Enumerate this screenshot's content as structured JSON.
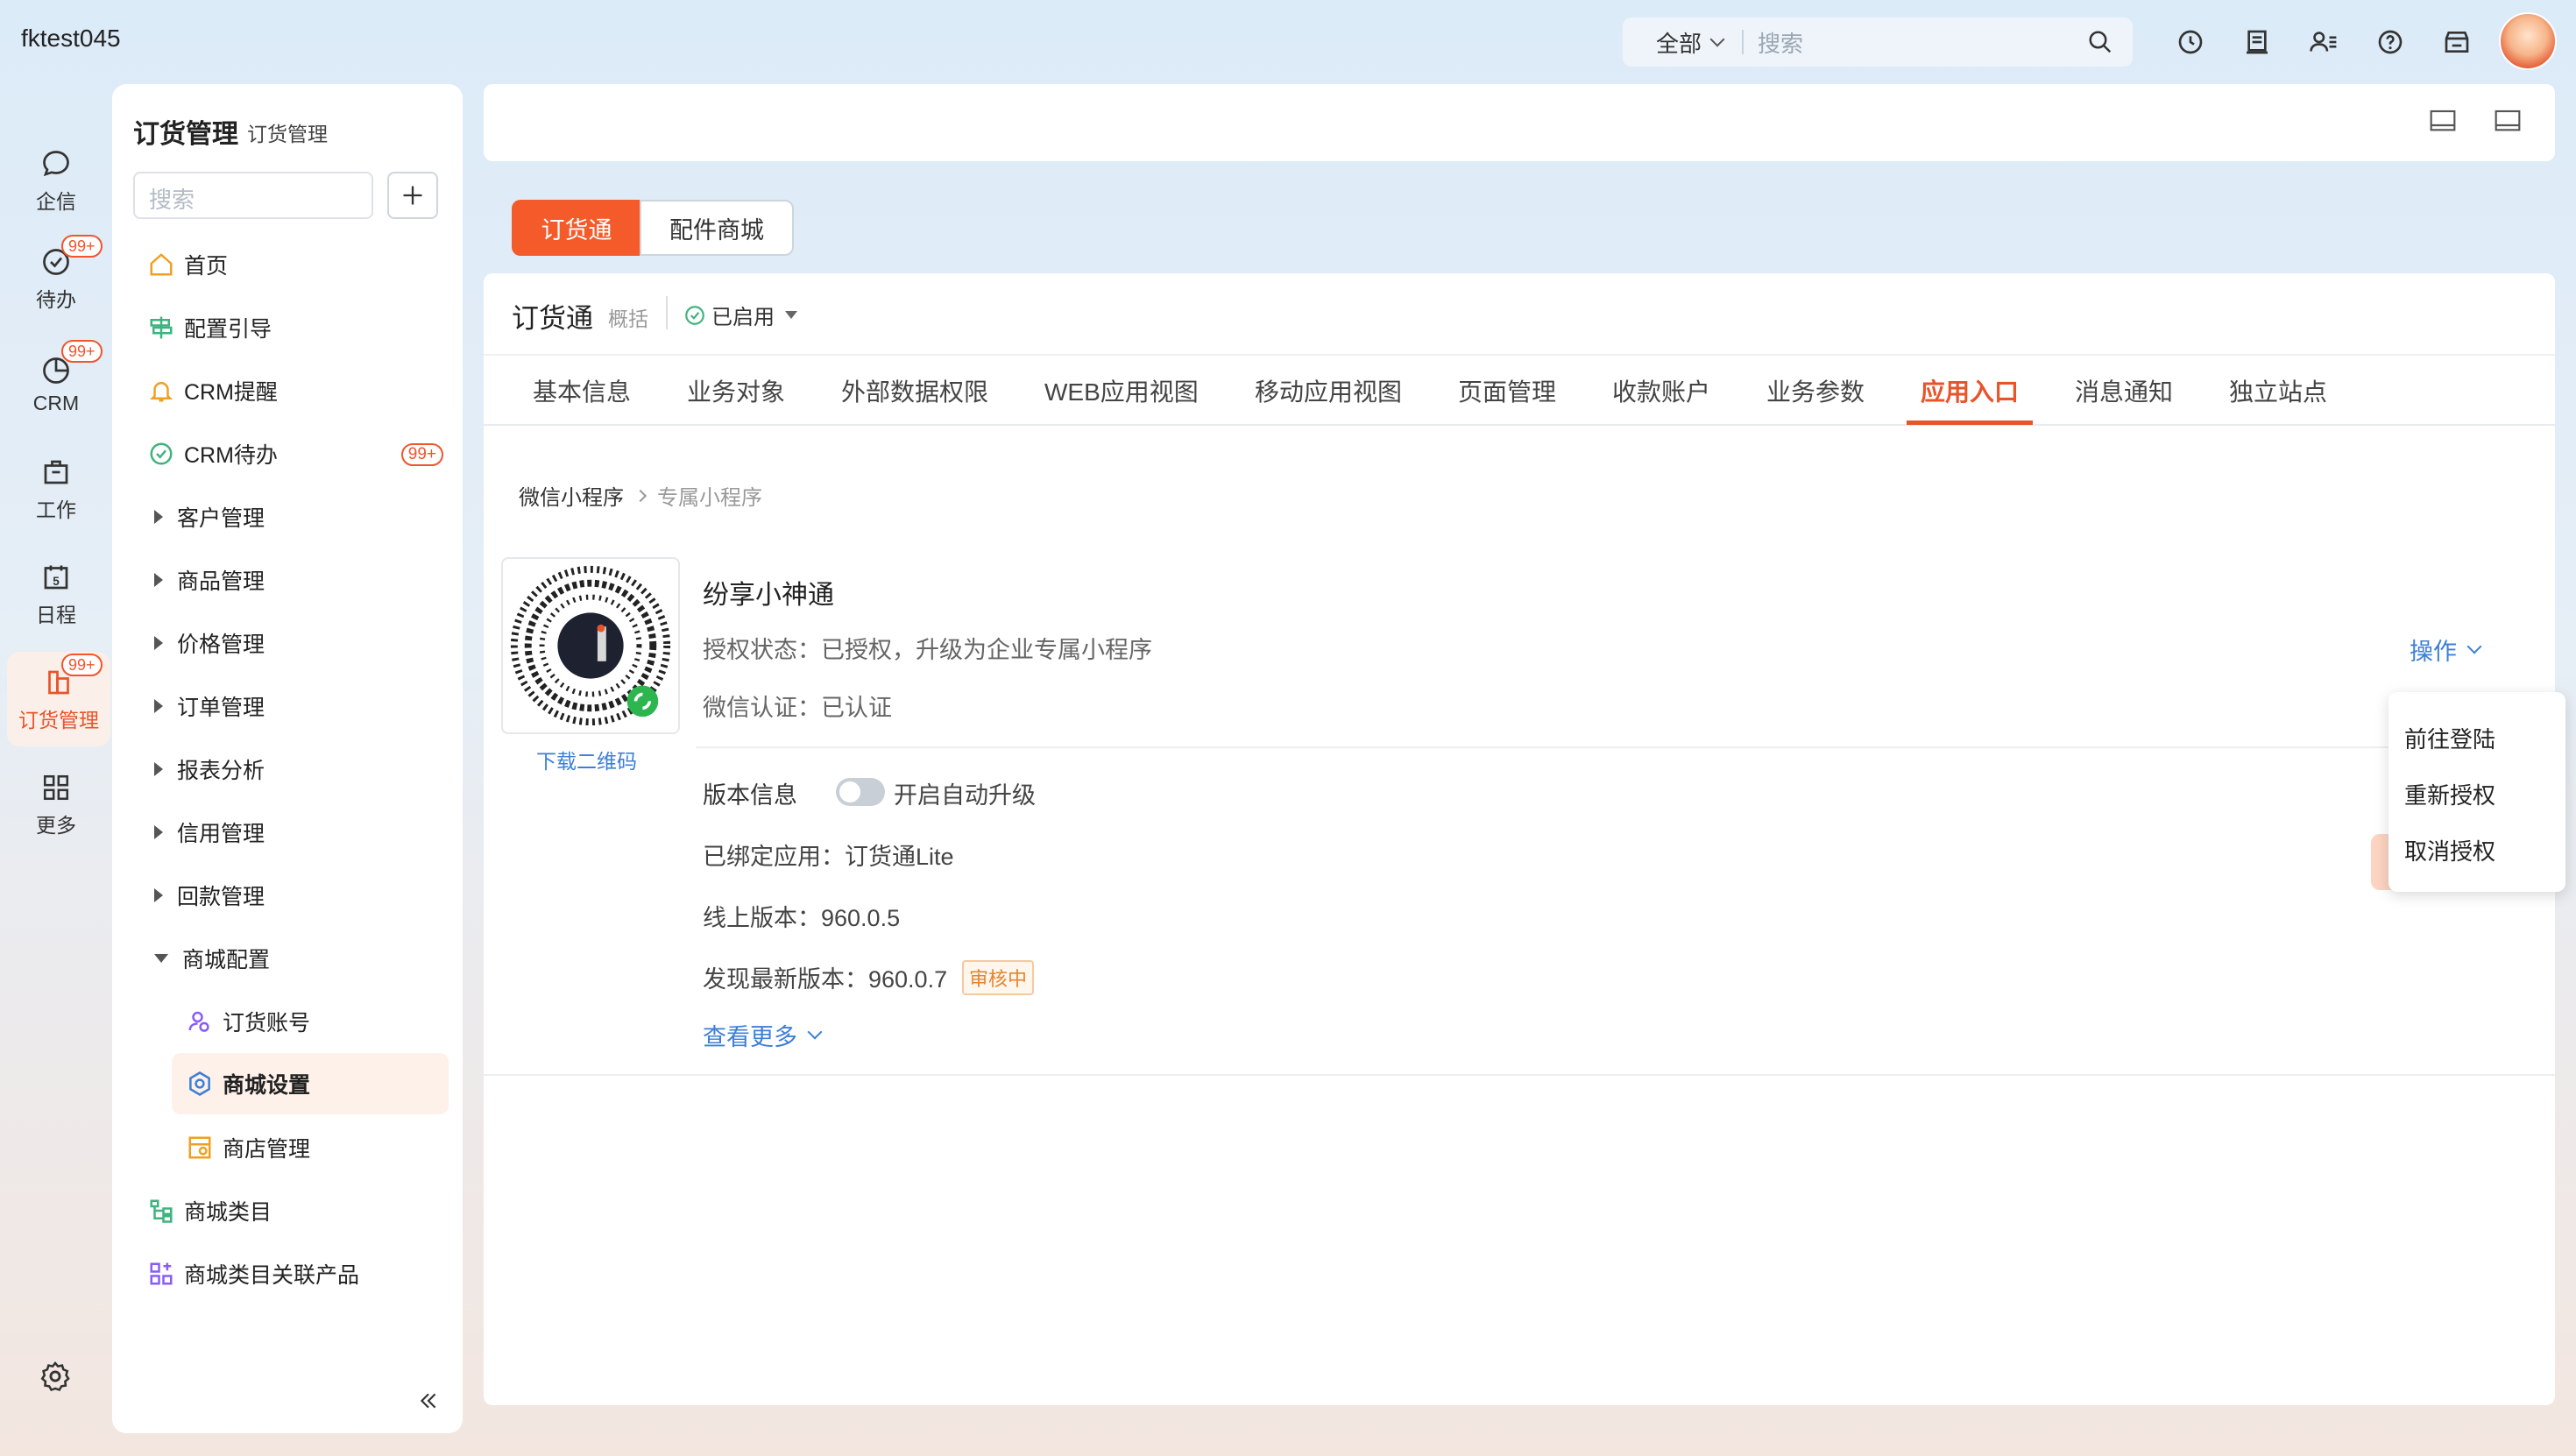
{
  "header": {
    "tenant": "fktest045",
    "search_scope": "全部",
    "search_placeholder": "搜索"
  },
  "rail": {
    "items": [
      {
        "label": "企信",
        "icon": "chat-icon"
      },
      {
        "label": "待办",
        "icon": "todo-check-icon",
        "badge": "99+"
      },
      {
        "label": "CRM",
        "icon": "pie-chart-icon",
        "badge": "99+"
      },
      {
        "label": "工作",
        "icon": "briefcase-icon"
      },
      {
        "label": "日程",
        "icon": "calendar-icon",
        "day": "5"
      },
      {
        "label": "订货管理",
        "icon": "order-icon",
        "badge": "99+",
        "active": true
      },
      {
        "label": "更多",
        "icon": "grid-icon"
      }
    ],
    "settings_icon": "gear-icon"
  },
  "side": {
    "title": "订货管理",
    "subtitle": "订货管理",
    "search_placeholder": "搜索",
    "items": [
      {
        "label": "首页",
        "icon": "home-icon"
      },
      {
        "label": "配置引导",
        "icon": "signpost-icon"
      },
      {
        "label": "CRM提醒",
        "icon": "bell-icon"
      },
      {
        "label": "CRM待办",
        "icon": "check-circle-icon",
        "badge": "99+"
      },
      {
        "label": "客户管理"
      },
      {
        "label": "商品管理"
      },
      {
        "label": "价格管理"
      },
      {
        "label": "订单管理"
      },
      {
        "label": "报表分析"
      },
      {
        "label": "信用管理"
      },
      {
        "label": "回款管理"
      },
      {
        "label": "商城配置",
        "expanded": true
      },
      {
        "label": "订货账号",
        "icon": "user-group-icon"
      },
      {
        "label": "商城设置",
        "icon": "settings-icon",
        "selected": true
      },
      {
        "label": "商店管理",
        "icon": "store-icon"
      },
      {
        "label": "商城类目",
        "icon": "tree-icon"
      },
      {
        "label": "商城类目关联产品",
        "icon": "link-grid-icon"
      }
    ]
  },
  "segments": [
    "订货通",
    "配件商城"
  ],
  "app": {
    "title": "订货通",
    "subtitle": "概括",
    "status": "已启用",
    "tabs": [
      "基本信息",
      "业务对象",
      "外部数据权限",
      "WEB应用视图",
      "移动应用视图",
      "页面管理",
      "收款账户",
      "业务参数",
      "应用入口",
      "消息通知",
      "独立站点"
    ],
    "active_tab": "应用入口"
  },
  "breadcrumb": [
    "微信小程序",
    "专属小程序"
  ],
  "miniprogram": {
    "download_label": "下载二维码",
    "name": "纷享小神通",
    "auth_status_label": "授权状态：",
    "auth_status_value": "已授权，升级为企业专属小程序",
    "wechat_cert_label": "微信认证：",
    "wechat_cert_value": "已认证",
    "ops_label": "操作",
    "version_label": "版本信息",
    "auto_upgrade_label": "开启自动升级",
    "auto_upgrade_on": false,
    "bound_app_label": "已绑定应用：",
    "bound_app_value": "订货通Lite",
    "online_version_label": "线上版本：",
    "online_version_value": "960.0.5",
    "latest_version_label": "发现最新版本：",
    "latest_version_value": "960.0.7",
    "review_tag": "审核中",
    "more_label": "查看更多"
  },
  "ops_menu": [
    "前往登陆",
    "重新授权",
    "取消授权"
  ],
  "colors": {
    "accent": "#f45a2a",
    "link": "#3d7fd6"
  }
}
